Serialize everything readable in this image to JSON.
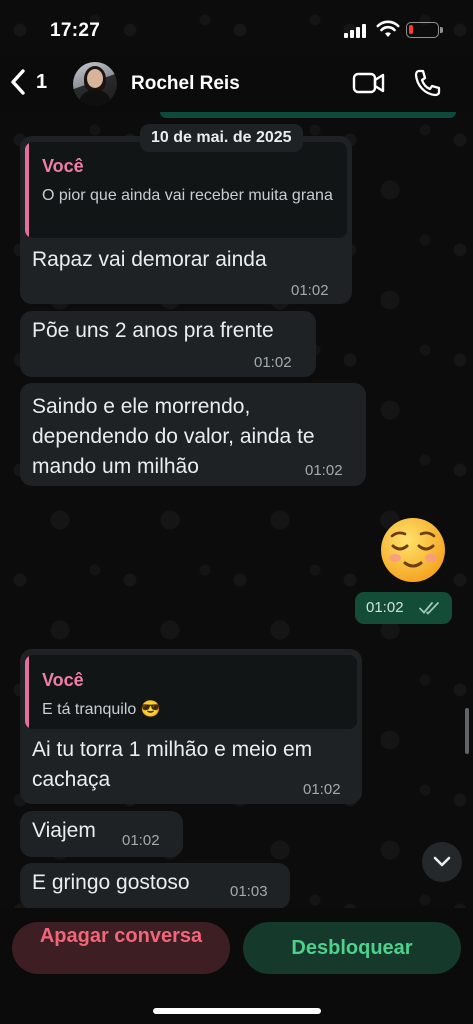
{
  "status_bar": {
    "time": "17:27"
  },
  "header": {
    "back_count": "1",
    "contact_name": "Rochel Reis"
  },
  "date_label": "10 de mai. de 2025",
  "messages": [
    {
      "quote_author": "Você",
      "quote_text": "O pior que ainda vai receber muita grana",
      "text": "Rapaz vai demorar ainda",
      "time": "01:02"
    },
    {
      "text": "Põe uns 2 anos pra frente",
      "time": "01:02"
    },
    {
      "text": "Saindo e ele morrendo, dependendo do valor, ainda te mando um milhão",
      "time": "01:02"
    },
    {
      "emoji": "😌",
      "time": "01:02",
      "status": "read"
    },
    {
      "quote_author": "Você",
      "quote_text": "E tá tranquilo 😎",
      "text": "Ai tu torra 1 milhão e meio em cachaça",
      "time": "01:02"
    },
    {
      "text": "Viajem",
      "time": "01:02"
    },
    {
      "text": "E gringo gostoso",
      "time": "01:03"
    }
  ],
  "actions": {
    "delete_label": "Apagar conversa",
    "unblock_label": "Desbloquear"
  },
  "colors": {
    "incoming_bubble": "#1f2224",
    "outgoing_bubble": "#134d37",
    "quote_accent": "#e4719c",
    "delete_text": "#f0677a",
    "unblock_text": "#4fd18b"
  }
}
